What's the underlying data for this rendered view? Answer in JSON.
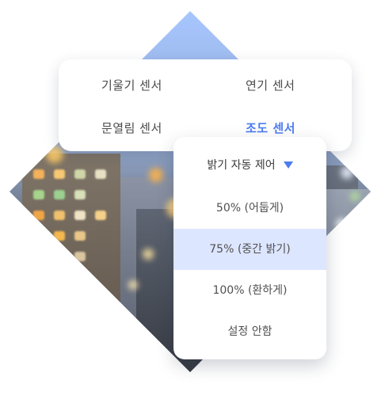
{
  "sensors": [
    {
      "label": "기울기 센서",
      "active": false
    },
    {
      "label": "연기 센서",
      "active": false
    },
    {
      "label": "문열림 센서",
      "active": false
    },
    {
      "label": "조도 센서",
      "active": true
    }
  ],
  "dropdown": {
    "title": "밝기 자동 제어",
    "caret_icon": "caret-down-icon",
    "options": [
      {
        "label": "50% (어둡게)",
        "selected": false
      },
      {
        "label": "75% (중간 밝기)",
        "selected": true
      },
      {
        "label": "100% (환하게)",
        "selected": false
      },
      {
        "label": "설정 안함",
        "selected": false
      }
    ]
  },
  "colors": {
    "accent": "#4d7cf0",
    "selected_bg": "#dde6ff"
  }
}
